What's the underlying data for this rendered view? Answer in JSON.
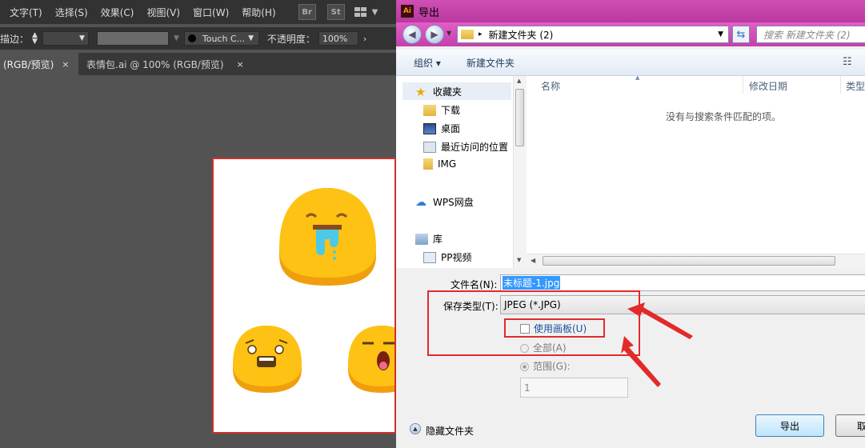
{
  "ai": {
    "menu": [
      "文字(T)",
      "选择(S)",
      "效果(C)",
      "视图(V)",
      "窗口(W)",
      "帮助(H)"
    ],
    "badges": [
      "Br",
      "St"
    ],
    "control": {
      "stroke_label": "描边：",
      "brush_name": "Touch C...",
      "opacity_label": "不透明度：",
      "opacity_value": "100%"
    },
    "tabs": [
      {
        "label": "(RGB/预览)",
        "close": "×"
      },
      {
        "label": "表情包.ai @ 100% (RGB/预览)",
        "close": "×"
      }
    ]
  },
  "dialog": {
    "title": "导出",
    "app_icon": "Ai",
    "path": "新建文件夹 (2)",
    "search_placeholder": "搜索 新建文件夹 (2)",
    "toolbar": {
      "organize": "组织 ▾",
      "new_folder": "新建文件夹"
    },
    "nav": {
      "favorites": "收藏夹",
      "downloads": "下载",
      "desktop": "桌面",
      "recent": "最近访问的位置",
      "img": "IMG",
      "wps": "WPS网盘",
      "library": "库",
      "video": "PP视频"
    },
    "columns": {
      "name": "名称",
      "modified": "修改日期",
      "type": "类型"
    },
    "empty_message": "没有与搜索条件匹配的项。",
    "form": {
      "filename_label": "文件名(N):",
      "filename_value": "未标题-1.jpg",
      "type_label": "保存类型(T):",
      "type_value": "JPEG (*.JPG)",
      "use_artboard": "使用画板(U)",
      "all": "全部(A)",
      "range": "范围(G):",
      "range_value": "1"
    },
    "hide_folders": "隐藏文件夹",
    "export_btn": "导出",
    "cancel_btn": "取"
  },
  "colors": {
    "title_bar": "#c440ac",
    "annotation_red": "#e22a2a",
    "emoji_yellow": "#fdc213",
    "emoji_shadow": "#f19e0e"
  }
}
